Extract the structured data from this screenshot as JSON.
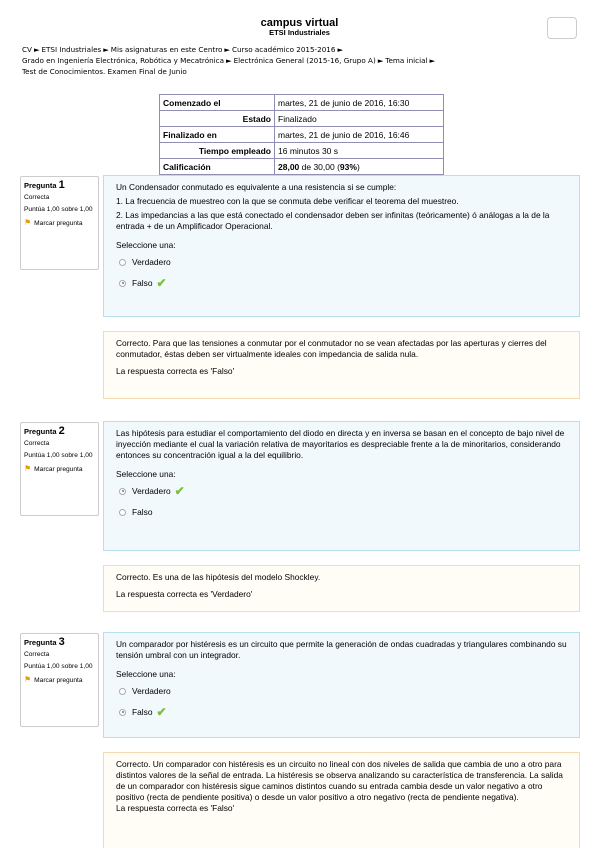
{
  "header": {
    "title": "campus virtual",
    "subtitle": "ETSI Industriales",
    "menu_icon": "menu-icon"
  },
  "breadcrumb": {
    "items": [
      "CV",
      "ETSI Industriales",
      "Mis asignaturas en este Centro",
      "Curso académico 2015-2016",
      "Grado en Ingeniería Electrónica, Robótica y Mecatrónica",
      "Electrónica General (2015-16, Grupo A)",
      "Tema inicial",
      "Test de Conocimientos. Examen Final de Junio"
    ],
    "separator": "►"
  },
  "summary": {
    "rows": [
      {
        "key": "Comenzado el",
        "value": "martes, 21 de junio de 2016, 16:30"
      },
      {
        "key": "Estado",
        "value": "Finalizado"
      },
      {
        "key": "Finalizado en",
        "value": "martes, 21 de junio de 2016, 16:46"
      },
      {
        "key": "Tiempo empleado",
        "value": "16 minutos 30 s"
      }
    ],
    "grade_key": "Calificación",
    "grade_bold": "28,00",
    "grade_mid": " de 30,00 (",
    "grade_pct": "93%",
    "grade_end": ")"
  },
  "questions": [
    {
      "label": "Pregunta",
      "number": "1",
      "status": "Correcta",
      "score": "Puntúa 1,00 sobre 1,00",
      "flag": "Marcar pregunta",
      "text": [
        "Un Condensador conmutado es equivalente a una resistencia si se cumple:",
        "1. La frecuencia de muestreo con la que se conmuta debe verificar el teorema del muestreo.",
        "2. Las impedancias a las que está conectado el condensador deben ser infinitas (teóricamente) ó análogas a la de la entrada + de un Amplificador Operacional."
      ],
      "prompt": "Seleccione una:",
      "options": [
        "Verdadero",
        "Falso"
      ],
      "selected": 1,
      "feedback": "Correcto. Para que las tensiones a conmutar por el conmutador no se vean afectadas por las aperturas y cierres del conmutador, éstas deben ser virtualmente ideales con impedancia de salida nula.",
      "correct_answer": "La respuesta correcta es 'Falso'"
    },
    {
      "label": "Pregunta",
      "number": "2",
      "status": "Correcta",
      "score": "Puntúa 1,00 sobre 1,00",
      "flag": "Marcar pregunta",
      "text": [
        "Las hipótesis para estudiar el comportamiento del diodo en directa y en inversa se basan en el concepto de bajo nivel de inyección mediante el cual la variación relativa de mayoritarios es despreciable frente a la de minoritarios, considerando entonces su concentración igual a la del equilibrio."
      ],
      "prompt": "Seleccione una:",
      "options": [
        "Verdadero",
        "Falso"
      ],
      "selected": 0,
      "feedback": "Correcto. Es una de las hipótesis del modelo Shockley.",
      "correct_answer": "La respuesta correcta es 'Verdadero'"
    },
    {
      "label": "Pregunta",
      "number": "3",
      "status": "Correcta",
      "score": "Puntúa 1,00 sobre 1,00",
      "flag": "Marcar pregunta",
      "text": [
        "Un comparador por histéresis es un circuito que permite la generación de ondas cuadradas y triangulares combinando su tensión umbral con un integrador."
      ],
      "prompt": "Seleccione una:",
      "options": [
        "Verdadero",
        "Falso"
      ],
      "selected": 1,
      "feedback": "Correcto. Un comparador con histéresis es un circuito no lineal con dos niveles de salida que cambia de uno a otro para distintos valores de la señal de entrada. La histéresis se observa analizando su característica de transferencia. La salida de un comparador con histéresis sigue caminos distintos cuando su entrada cambia desde un valor negativo a otro positivo (recta de pendiente positiva) o desde un valor positivo a otro negativo (recta de pendiente negativa).",
      "correct_answer": "La respuesta correcta es 'Falso'"
    }
  ],
  "icons": {
    "flag": "flag-icon",
    "check": "checkmark-icon"
  },
  "colors": {
    "question_bg": "#f2f9fd",
    "question_border": "#b8dff0",
    "feedback_bg": "#fffdf6",
    "feedback_border": "#f3dcb2",
    "check": "#7bbf3a",
    "flag": "#e0a100"
  }
}
